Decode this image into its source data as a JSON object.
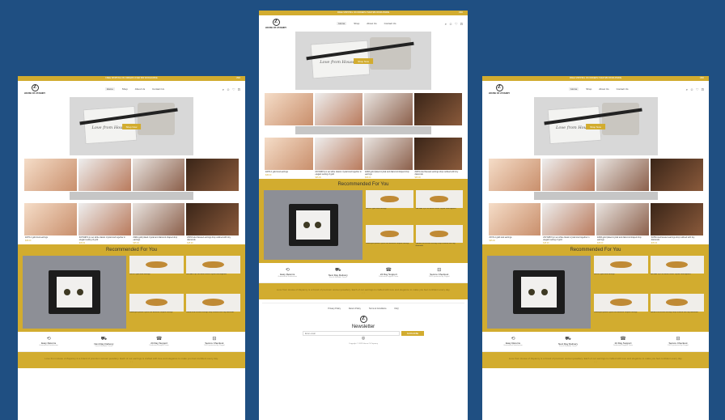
{
  "announcement": "FREE SHIPPING ON ORDERS OVER $50 WORLDWIDE",
  "language": "USD",
  "brand": {
    "monogram": "Z",
    "name": "HOUSE OF ZAYANNY"
  },
  "nav": [
    "Home",
    "Shop",
    "About Us",
    "Contact Us"
  ],
  "hero": {
    "cta": "Shop Now",
    "script": "Love from House"
  },
  "products_row1": [
    {
      "name": "ZAYN-1 gold stud earrings",
      "price": "$45.00"
    },
    {
      "name": "ZAYNAB 9 pc set white classic crystal",
      "price": "$45.00"
    },
    {
      "name": "ZARA gold plated crystal drop earrings",
      "price": "$45.00"
    },
    {
      "name": "ZAHIA stud earrings with accents",
      "price": "$45.00"
    }
  ],
  "products_row2": [
    {
      "name": "ZAYN-1 gold stud earrings",
      "price": "$45.00"
    },
    {
      "name": "ZAYNAB 9 pc set white classic crystal stud together in elegant setting of gold",
      "price": "$45.00"
    },
    {
      "name": "ZARA gold plated crystal and diamond shaped drop earrings",
      "price": "$45.00"
    },
    {
      "name": "ZAHIA stud faceted earrings drop outlined with tiny diamonds",
      "price": "$45.00"
    }
  ],
  "recommended": {
    "title": "Recommended For You",
    "items": [
      "ZAYN-1 gold stud earrings",
      "ZAYNAB 9 pc set white classic crystal stud together",
      "ZARA gold plated crystal and diamond shaped earrings",
      "ZAHIA stud faceted earrings drop outlined with tiny diamonds"
    ]
  },
  "features": [
    {
      "icon": "returns-icon",
      "title": "Easy Returns",
      "sub": "Guaranteed Satisfaction"
    },
    {
      "icon": "delivery-icon",
      "title": "Next Day Delivery",
      "sub": "Fast & Reliable Travel"
    },
    {
      "icon": "support-icon",
      "title": "24 Day Support",
      "sub": "Dedicated Support Team"
    },
    {
      "icon": "checkout-icon",
      "title": "Secure Checkout",
      "sub": "100% protected by Paypal"
    }
  ],
  "about": "Love from House of Zayanny is a brand of premium women jewellery. Each of our earrings is crafted with love and elegance to make you feel confident every day.",
  "footer": {
    "links": [
      "Privacy Policy",
      "Return Policy",
      "Terms & Conditions",
      "FAQ"
    ],
    "newsletter": "Newsletter",
    "email_placeholder": "Enter email",
    "subscribe": "SUBSCRIBE",
    "copyright": "Copyright © 2023 House Of Zayanny"
  },
  "colors": {
    "accent": "#d2ac2f",
    "backdrop": "#1f4f82"
  }
}
